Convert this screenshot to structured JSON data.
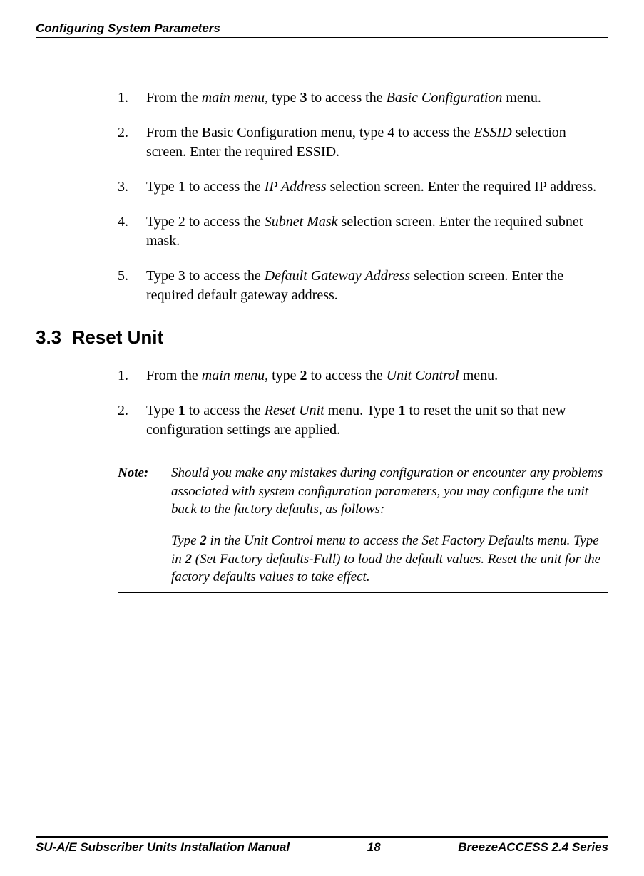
{
  "header": {
    "running_title": "Configuring System Parameters"
  },
  "list1": {
    "items": [
      {
        "num": "1.",
        "pre": "From the ",
        "i1": "main menu",
        "mid1": ", type ",
        "b1": "3",
        "mid2": " to access the ",
        "i2": "Basic Configuration",
        "post": " menu."
      },
      {
        "num": "2.",
        "pre": "From the Basic Configuration menu, type 4 to access the ",
        "i1": "ESSID",
        "mid1": " selection screen. Enter the required ESSID.",
        "b1": "",
        "mid2": "",
        "i2": "",
        "post": ""
      },
      {
        "num": "3.",
        "pre": "Type 1 to access the ",
        "i1": "IP Address",
        "mid1": " selection screen. Enter the required IP address.",
        "b1": "",
        "mid2": "",
        "i2": "",
        "post": ""
      },
      {
        "num": "4.",
        "pre": "Type 2 to access the ",
        "i1": "Subnet Mask",
        "mid1": " selection screen. Enter the required subnet mask.",
        "b1": "",
        "mid2": "",
        "i2": "",
        "post": ""
      },
      {
        "num": "5.",
        "pre": "Type 3 to access the ",
        "i1": "Default Gateway Address",
        "mid1": " selection screen. Enter the required default gateway address.",
        "b1": "",
        "mid2": "",
        "i2": "",
        "post": ""
      }
    ]
  },
  "section": {
    "number": "3.3",
    "title": "Reset Unit"
  },
  "list2": {
    "items": [
      {
        "num": "1.",
        "pre": "From the ",
        "i1": "main menu",
        "mid1": ", type ",
        "b1": "2",
        "mid2": " to access the ",
        "i2": "Unit Control",
        "post": " menu."
      },
      {
        "num": "2.",
        "pre": "Type ",
        "b1": "1",
        "mid1": " to access the ",
        "i1": "Reset Unit",
        "mid2": " menu. Type ",
        "b2": "1",
        "post": " to reset the unit so that new configuration settings are applied."
      }
    ]
  },
  "note": {
    "label": "Note:",
    "para1": "Should you make any mistakes during configuration or encounter any problems associated with system configuration parameters, you may configure the unit back to the factory defaults, as follows:",
    "para2_pre": "Type ",
    "para2_b1": "2",
    "para2_mid1": " in the Unit Control menu to access the Set Factory Defaults menu. Type in ",
    "para2_b2": "2",
    "para2_post": " (Set Factory defaults-Full) to load the default values. Reset the unit for the factory defaults values to take effect."
  },
  "footer": {
    "left": "SU-A/E Subscriber Units Installation Manual",
    "center": "18",
    "right": "BreezeACCESS 2.4 Series"
  }
}
